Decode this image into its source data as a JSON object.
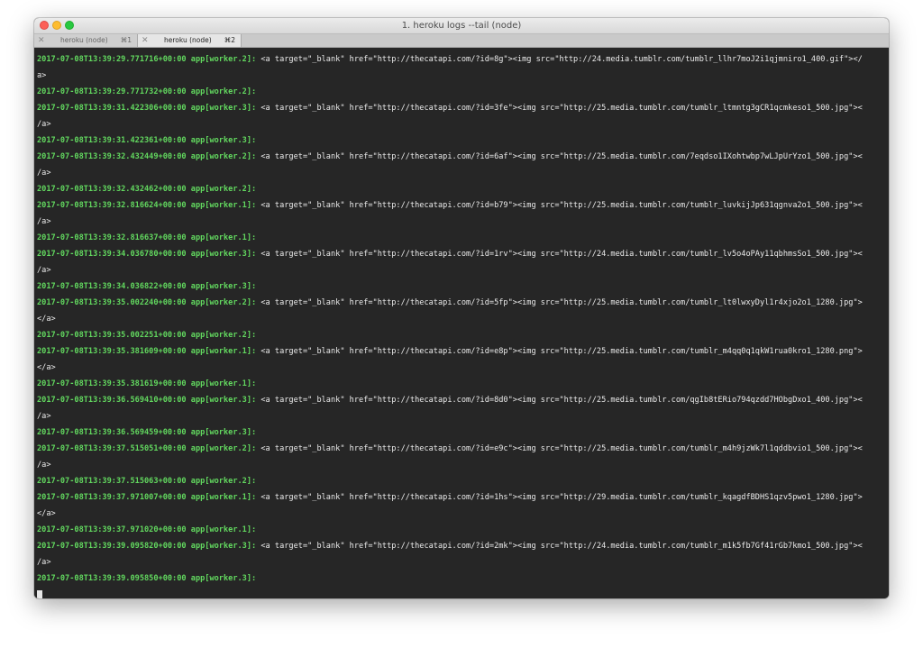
{
  "window": {
    "title": "1. heroku logs --tail (node)"
  },
  "tabs": [
    {
      "close": "✕",
      "label": "heroku (node)",
      "shortcut": "⌘1"
    },
    {
      "close": "✕",
      "label": "heroku (node)",
      "shortcut": "⌘2"
    }
  ],
  "terminal": {
    "lines": [
      {
        "ts": "2017-07-08T13:39:29.771716+00:00",
        "src": "app[worker.2]:",
        "msg": " <a target=\"_blank\" href=\"http://thecatapi.com/?id=8g\"><img src=\"http://24.media.tumblr.com/tumblr_llhr7moJ2i1qjmniro1_400.gif\"></"
      },
      {
        "ts": "",
        "src": "",
        "msg": "a>"
      },
      {
        "ts": "2017-07-08T13:39:29.771732+00:00",
        "src": "app[worker.2]:",
        "msg": ""
      },
      {
        "ts": "2017-07-08T13:39:31.422306+00:00",
        "src": "app[worker.3]:",
        "msg": " <a target=\"_blank\" href=\"http://thecatapi.com/?id=3fe\"><img src=\"http://25.media.tumblr.com/tumblr_ltmntg3gCR1qcmkeso1_500.jpg\"><"
      },
      {
        "ts": "",
        "src": "",
        "msg": "/a>"
      },
      {
        "ts": "2017-07-08T13:39:31.422361+00:00",
        "src": "app[worker.3]:",
        "msg": ""
      },
      {
        "ts": "2017-07-08T13:39:32.432449+00:00",
        "src": "app[worker.2]:",
        "msg": " <a target=\"_blank\" href=\"http://thecatapi.com/?id=6af\"><img src=\"http://25.media.tumblr.com/7eqdso1IXohtwbp7wLJpUrYzo1_500.jpg\"><"
      },
      {
        "ts": "",
        "src": "",
        "msg": "/a>"
      },
      {
        "ts": "2017-07-08T13:39:32.432462+00:00",
        "src": "app[worker.2]:",
        "msg": ""
      },
      {
        "ts": "2017-07-08T13:39:32.816624+00:00",
        "src": "app[worker.1]:",
        "msg": " <a target=\"_blank\" href=\"http://thecatapi.com/?id=b79\"><img src=\"http://25.media.tumblr.com/tumblr_luvkijJp631qgnva2o1_500.jpg\"><"
      },
      {
        "ts": "",
        "src": "",
        "msg": "/a>"
      },
      {
        "ts": "2017-07-08T13:39:32.816637+00:00",
        "src": "app[worker.1]:",
        "msg": ""
      },
      {
        "ts": "2017-07-08T13:39:34.036780+00:00",
        "src": "app[worker.3]:",
        "msg": " <a target=\"_blank\" href=\"http://thecatapi.com/?id=1rv\"><img src=\"http://24.media.tumblr.com/tumblr_lv5o4oPAy11qbhmsSo1_500.jpg\"><"
      },
      {
        "ts": "",
        "src": "",
        "msg": "/a>"
      },
      {
        "ts": "2017-07-08T13:39:34.036822+00:00",
        "src": "app[worker.3]:",
        "msg": ""
      },
      {
        "ts": "2017-07-08T13:39:35.002240+00:00",
        "src": "app[worker.2]:",
        "msg": " <a target=\"_blank\" href=\"http://thecatapi.com/?id=5fp\"><img src=\"http://25.media.tumblr.com/tumblr_lt0lwxyDyl1r4xjo2o1_1280.jpg\">"
      },
      {
        "ts": "",
        "src": "",
        "msg": "</a>"
      },
      {
        "ts": "2017-07-08T13:39:35.002251+00:00",
        "src": "app[worker.2]:",
        "msg": ""
      },
      {
        "ts": "2017-07-08T13:39:35.381609+00:00",
        "src": "app[worker.1]:",
        "msg": " <a target=\"_blank\" href=\"http://thecatapi.com/?id=e8p\"><img src=\"http://25.media.tumblr.com/tumblr_m4qq0q1qkW1rua0kro1_1280.png\">"
      },
      {
        "ts": "",
        "src": "",
        "msg": "</a>"
      },
      {
        "ts": "2017-07-08T13:39:35.381619+00:00",
        "src": "app[worker.1]:",
        "msg": ""
      },
      {
        "ts": "2017-07-08T13:39:36.569410+00:00",
        "src": "app[worker.3]:",
        "msg": " <a target=\"_blank\" href=\"http://thecatapi.com/?id=8d0\"><img src=\"http://25.media.tumblr.com/qgIb8tERio794qzdd7HObgDxo1_400.jpg\"><"
      },
      {
        "ts": "",
        "src": "",
        "msg": "/a>"
      },
      {
        "ts": "2017-07-08T13:39:36.569459+00:00",
        "src": "app[worker.3]:",
        "msg": ""
      },
      {
        "ts": "2017-07-08T13:39:37.515051+00:00",
        "src": "app[worker.2]:",
        "msg": " <a target=\"_blank\" href=\"http://thecatapi.com/?id=e9c\"><img src=\"http://25.media.tumblr.com/tumblr_m4h9jzWk7l1qddbvio1_500.jpg\"><"
      },
      {
        "ts": "",
        "src": "",
        "msg": "/a>"
      },
      {
        "ts": "2017-07-08T13:39:37.515063+00:00",
        "src": "app[worker.2]:",
        "msg": ""
      },
      {
        "ts": "2017-07-08T13:39:37.971007+00:00",
        "src": "app[worker.1]:",
        "msg": " <a target=\"_blank\" href=\"http://thecatapi.com/?id=1hs\"><img src=\"http://29.media.tumblr.com/tumblr_kqagdfBDHS1qzv5pwo1_1280.jpg\">"
      },
      {
        "ts": "",
        "src": "",
        "msg": "</a>"
      },
      {
        "ts": "2017-07-08T13:39:37.971020+00:00",
        "src": "app[worker.1]:",
        "msg": ""
      },
      {
        "ts": "2017-07-08T13:39:39.095820+00:00",
        "src": "app[worker.3]:",
        "msg": " <a target=\"_blank\" href=\"http://thecatapi.com/?id=2mk\"><img src=\"http://24.media.tumblr.com/tumblr_m1k5fb7Gf41rGb7kmo1_500.jpg\"><"
      },
      {
        "ts": "",
        "src": "",
        "msg": "/a>"
      },
      {
        "ts": "2017-07-08T13:39:39.095850+00:00",
        "src": "app[worker.3]:",
        "msg": ""
      }
    ]
  }
}
